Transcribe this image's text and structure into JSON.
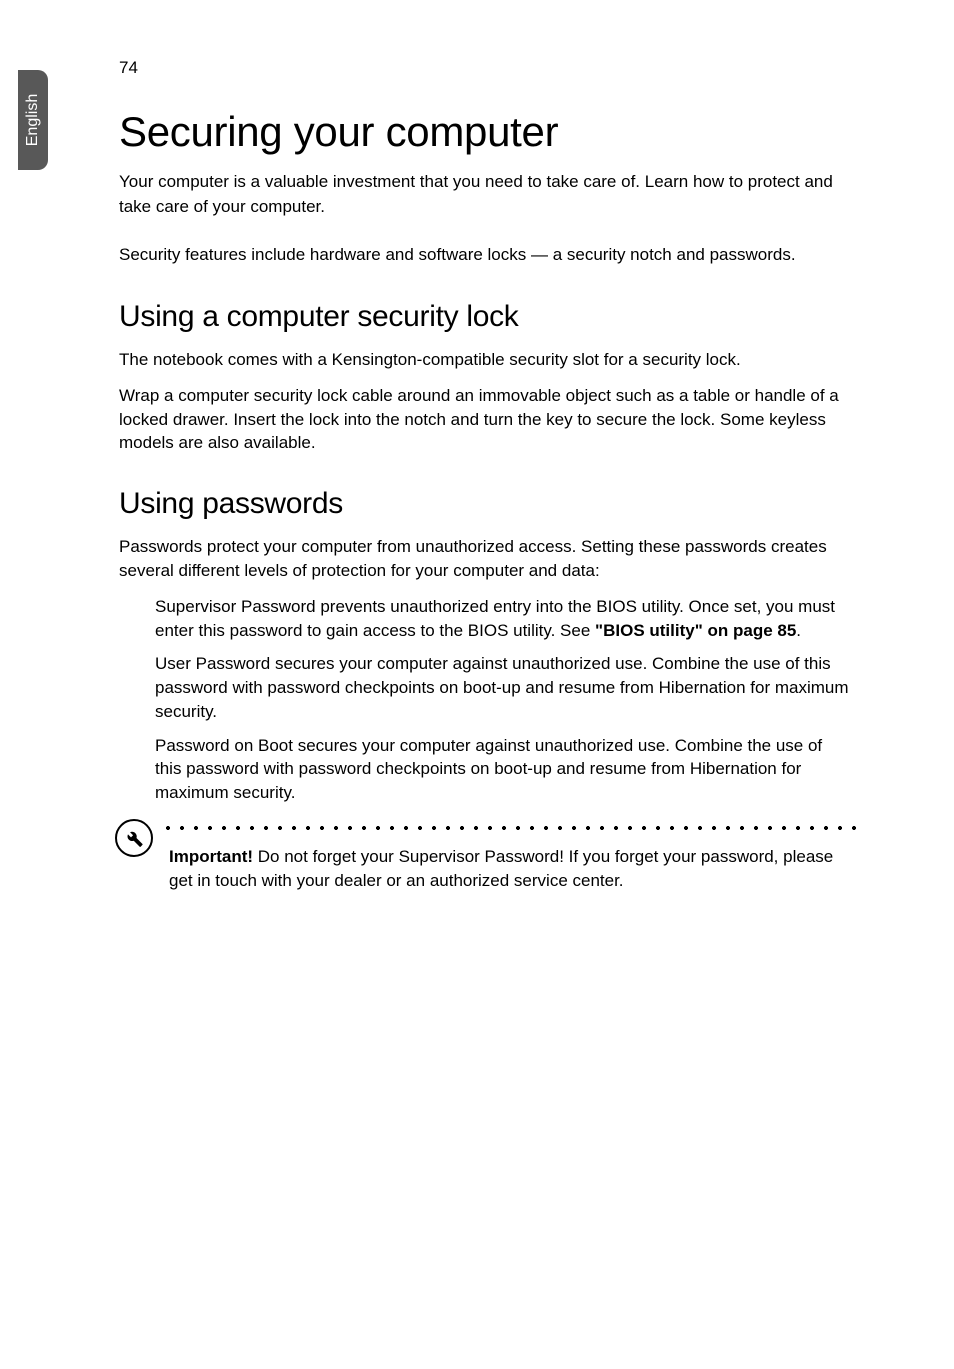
{
  "page": {
    "language_tab": "English",
    "number": "74"
  },
  "title": "Securing your computer",
  "intro_p1": "Your computer is a valuable investment that you need to take care of. Learn how to protect and take care of your computer.",
  "intro_p2": "Security features include hardware and software locks — a security notch and passwords.",
  "section1": {
    "heading": "Using a computer security lock",
    "p1": "The notebook comes with a Kensington-compatible security slot for a security lock.",
    "p2": "Wrap a computer security lock cable around an immovable object such as a table or handle of a locked drawer. Insert the lock into the notch and turn the key to secure the lock. Some keyless models are also available."
  },
  "section2": {
    "heading": "Using passwords",
    "p1": "Passwords protect your computer from unauthorized access. Setting these passwords creates several different levels of protection for your computer and data:",
    "items": [
      {
        "text_before": "Supervisor Password prevents unauthorized entry into the BIOS utility. Once set, you must enter this password to gain access to the BIOS utility. See ",
        "link": "\"BIOS utility\" on page 85",
        "text_after": "."
      },
      {
        "full": "User Password secures your computer against unauthorized use. Combine the use of this password with password checkpoints on boot-up and resume from Hibernation for maximum security."
      },
      {
        "full": "Password on Boot secures your computer against unauthorized use. Combine the use of this password with password checkpoints on boot-up and resume from Hibernation for maximum security."
      }
    ],
    "important": {
      "label": "Important!",
      "text": " Do not forget your Supervisor Password! If you forget your password, please get in touch with your dealer or an authorized service center."
    }
  }
}
